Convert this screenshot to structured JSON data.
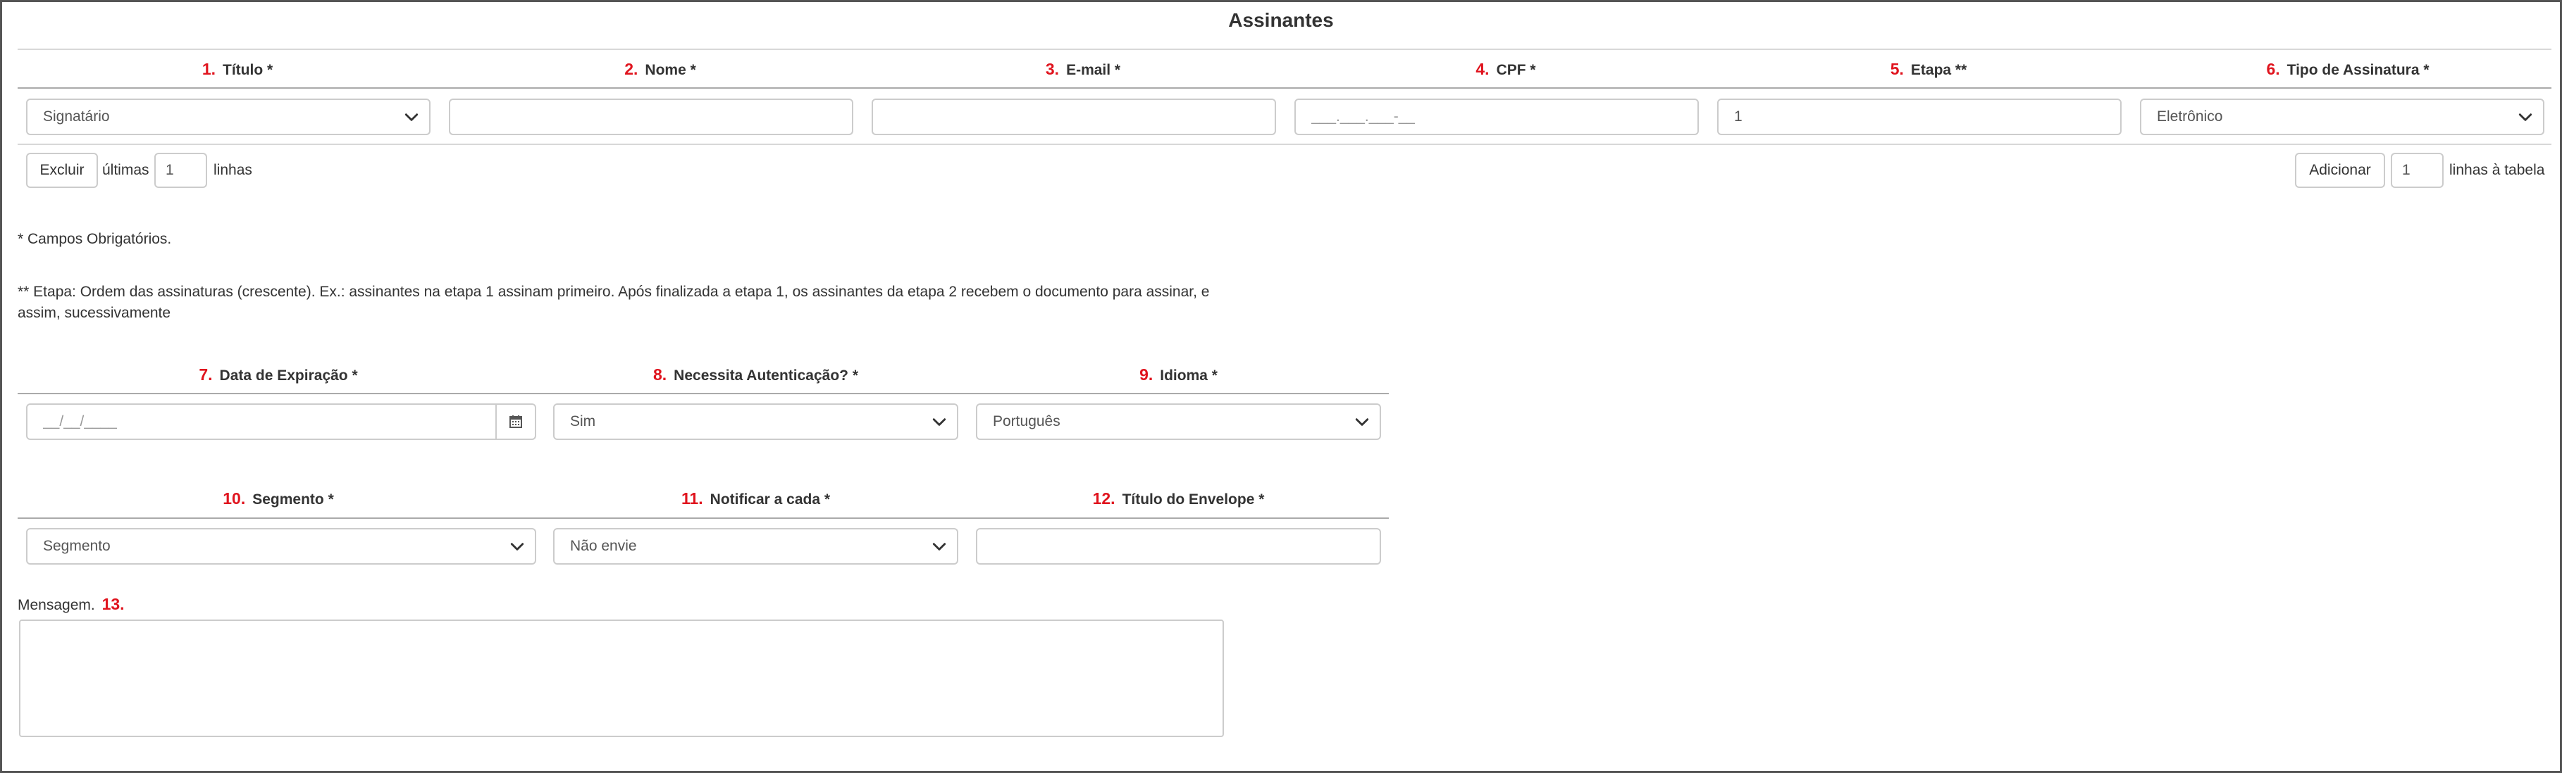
{
  "section_title": "Assinantes",
  "signers_columns": [
    {
      "num": "1.",
      "label": "Título *"
    },
    {
      "num": "2.",
      "label": "Nome *"
    },
    {
      "num": "3.",
      "label": "E-mail *"
    },
    {
      "num": "4.",
      "label": "CPF *"
    },
    {
      "num": "5.",
      "label": "Etapa **"
    },
    {
      "num": "6.",
      "label": "Tipo de Assinatura *"
    }
  ],
  "signers_row": {
    "titulo": "Signatário",
    "nome": "",
    "email": "",
    "cpf_placeholder": "___.___.___-__",
    "etapa": "1",
    "tipo": "Eletrônico"
  },
  "toolbar": {
    "delete_label": "Excluir",
    "last_label": "últimas",
    "delete_count": "1",
    "lines_label": "linhas",
    "add_label": "Adicionar",
    "add_count": "1",
    "lines_to_table_label": "linhas à tabela"
  },
  "notes": {
    "required": "* Campos Obrigatórios.",
    "etapa": "** Etapa: Ordem das assinaturas (crescente). Ex.: assinantes na etapa 1 assinam primeiro. Após finalizada a etapa 1, os assinantes da etapa 2 recebem o documento para assinar, e assim, sucessivamente"
  },
  "settings_row1": {
    "columns": [
      {
        "num": "7.",
        "label": "Data de Expiração *"
      },
      {
        "num": "8.",
        "label": "Necessita Autenticação? *"
      },
      {
        "num": "9.",
        "label": "Idioma *"
      }
    ],
    "date_placeholder": "__/__/____",
    "autenticacao": "Sim",
    "idioma": "Português"
  },
  "settings_row2": {
    "columns": [
      {
        "num": "10.",
        "label": "Segmento *"
      },
      {
        "num": "11.",
        "label": "Notificar a cada *"
      },
      {
        "num": "12.",
        "label": "Título do Envelope *"
      }
    ],
    "segmento": "Segmento",
    "notificar": "Não envie",
    "titulo_envelope": ""
  },
  "message": {
    "label": "Mensagem.",
    "num": "13.",
    "value": ""
  },
  "icons": {
    "select": "chevron-down-icon",
    "date": "calendar-icon"
  },
  "colors": {
    "number_accent": "#e0141e",
    "border": "#cccccc",
    "text": "#333333"
  }
}
